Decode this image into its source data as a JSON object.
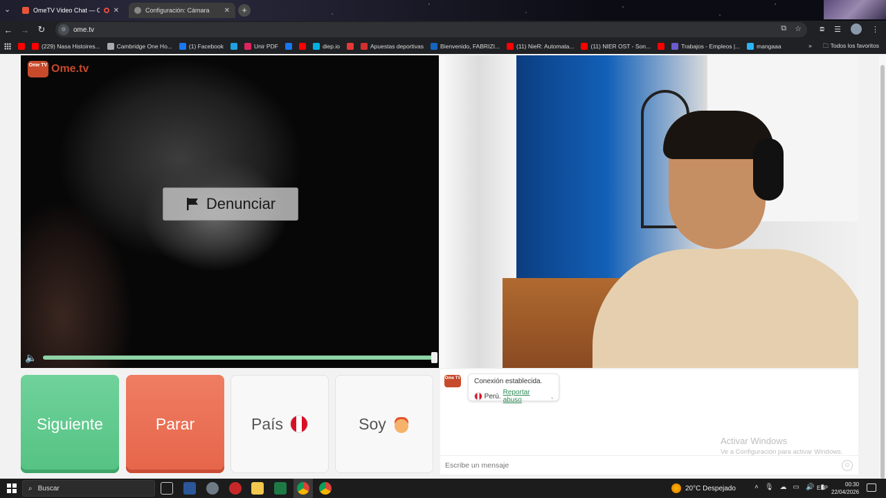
{
  "browser": {
    "tabs": [
      {
        "title": "OmeTV Video Chat — Ome",
        "active": true
      },
      {
        "title": "Configuración: Cámara",
        "active": false
      }
    ],
    "url": "ome.tv",
    "bookmarks": [
      {
        "label": "",
        "icon": "youtube-icon",
        "color": "#ff0000"
      },
      {
        "label": "(229) Nasa Histoires...",
        "icon": "youtube-icon",
        "color": "#ff0000"
      },
      {
        "label": "Cambridge One Ho...",
        "icon": "cambridge-icon",
        "color": "#aaaaaa"
      },
      {
        "label": "(1) Facebook",
        "icon": "facebook-icon",
        "color": "#1877f2"
      },
      {
        "label": "",
        "icon": "edge-icon",
        "color": "#1fa0e0"
      },
      {
        "label": "Unir PDF",
        "icon": "heart-icon",
        "color": "#e0245e"
      },
      {
        "label": "",
        "icon": "facebook-icon",
        "color": "#1877f2"
      },
      {
        "label": "",
        "icon": "youtube-icon",
        "color": "#ff0000"
      },
      {
        "label": "diep.io",
        "icon": "diep-icon",
        "color": "#00b2e1"
      },
      {
        "label": "",
        "icon": "warning-icon",
        "color": "#e53935"
      },
      {
        "label": "Apuestas deportivas",
        "icon": "bet-icon",
        "color": "#d32f2f"
      },
      {
        "label": "Bienvenido, FABRIZI...",
        "icon": "a-icon",
        "color": "#1565c0"
      },
      {
        "label": "(11) NieR: Automata...",
        "icon": "youtube-icon",
        "color": "#ff0000"
      },
      {
        "label": "(11) NIER OST - Son...",
        "icon": "youtube-icon",
        "color": "#ff0000"
      },
      {
        "label": "",
        "icon": "youtube-icon",
        "color": "#ff0000"
      },
      {
        "label": "Trabajos - Empleos |...",
        "icon": "jobs-icon",
        "color": "#6a5acd"
      },
      {
        "label": "mangaaa",
        "icon": "globe-icon",
        "color": "#29b6f6"
      }
    ],
    "bookmarks_overflow": "»",
    "all_favorites": "Todos los favoritos"
  },
  "app": {
    "logo_text": "Ome.tv",
    "logo_badge": "Ome TV",
    "report_label": "Denunciar",
    "buttons": {
      "next": "Siguiente",
      "stop": "Parar",
      "country": "País",
      "gender": "Soy"
    },
    "chat": {
      "status_line": "Conexión establecida.",
      "country": "Perú.",
      "report_abuse": "Reportar abuso",
      "report_suffix": ".",
      "input_placeholder": "Escribe un mensaje"
    },
    "volume_level": 1.0
  },
  "watermark": {
    "line1": "Activar Windows",
    "line2": "Ve a Configuración para activar Windows."
  },
  "taskbar": {
    "search_label": "Buscar",
    "weather": "20°C  Despejado",
    "language": "ESP",
    "time": "00:30",
    "date": "22/04/2026"
  },
  "colors": {
    "next": "#5ccb8b",
    "stop": "#e96d51",
    "brand": "#c84a2c",
    "link": "#2e8b57"
  }
}
